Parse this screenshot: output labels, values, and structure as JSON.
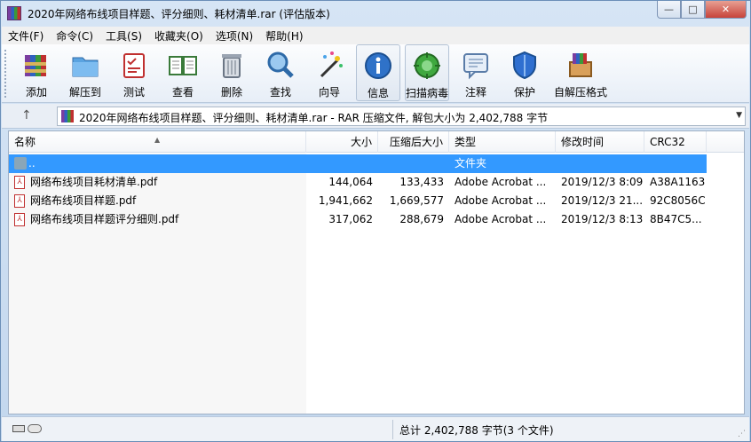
{
  "window": {
    "title": "2020年网络布线项目样题、评分细则、耗材清单.rar (评估版本)"
  },
  "menu": [
    "文件(F)",
    "命令(C)",
    "工具(S)",
    "收藏夹(O)",
    "选项(N)",
    "帮助(H)"
  ],
  "toolbar": [
    {
      "label": "添加",
      "icon": "add-archive-icon"
    },
    {
      "label": "解压到",
      "icon": "extract-to-icon"
    },
    {
      "label": "测试",
      "icon": "test-icon"
    },
    {
      "label": "查看",
      "icon": "view-book-icon"
    },
    {
      "label": "删除",
      "icon": "trash-icon"
    },
    {
      "label": "查找",
      "icon": "magnifier-icon"
    },
    {
      "label": "向导",
      "icon": "wizard-wand-icon"
    },
    {
      "label": "信息",
      "icon": "info-icon"
    },
    {
      "label": "扫描病毒",
      "icon": "virus-scan-icon"
    },
    {
      "label": "注释",
      "icon": "comment-icon"
    },
    {
      "label": "保护",
      "icon": "shield-icon"
    },
    {
      "label": "自解压格式",
      "icon": "sfx-box-icon"
    }
  ],
  "address": {
    "text": "2020年网络布线项目样题、评分细则、耗材清单.rar - RAR 压缩文件, 解包大小为 2,402,788 字节"
  },
  "columns": {
    "name": "名称",
    "size": "大小",
    "packed": "压缩后大小",
    "type": "类型",
    "modified": "修改时间",
    "crc": "CRC32"
  },
  "parent_row": {
    "name": "..",
    "type": "文件夹"
  },
  "files": [
    {
      "name": "网络布线项目耗材清单.pdf",
      "size": "144,064",
      "packed": "133,433",
      "type": "Adobe Acrobat ...",
      "modified": "2019/12/3 8:09",
      "crc": "A38A1163"
    },
    {
      "name": "网络布线项目样题.pdf",
      "size": "1,941,662",
      "packed": "1,669,577",
      "type": "Adobe Acrobat ...",
      "modified": "2019/12/3 21...",
      "crc": "92C8056C"
    },
    {
      "name": "网络布线项目样题评分细则.pdf",
      "size": "317,062",
      "packed": "288,679",
      "type": "Adobe Acrobat ...",
      "modified": "2019/12/3 8:13",
      "crc": "8B47C5..."
    }
  ],
  "status": {
    "summary": "总计 2,402,788 字节(3 个文件)"
  },
  "colors": {
    "selection": "#3399ff",
    "title_bg": "#c9dcf0"
  }
}
